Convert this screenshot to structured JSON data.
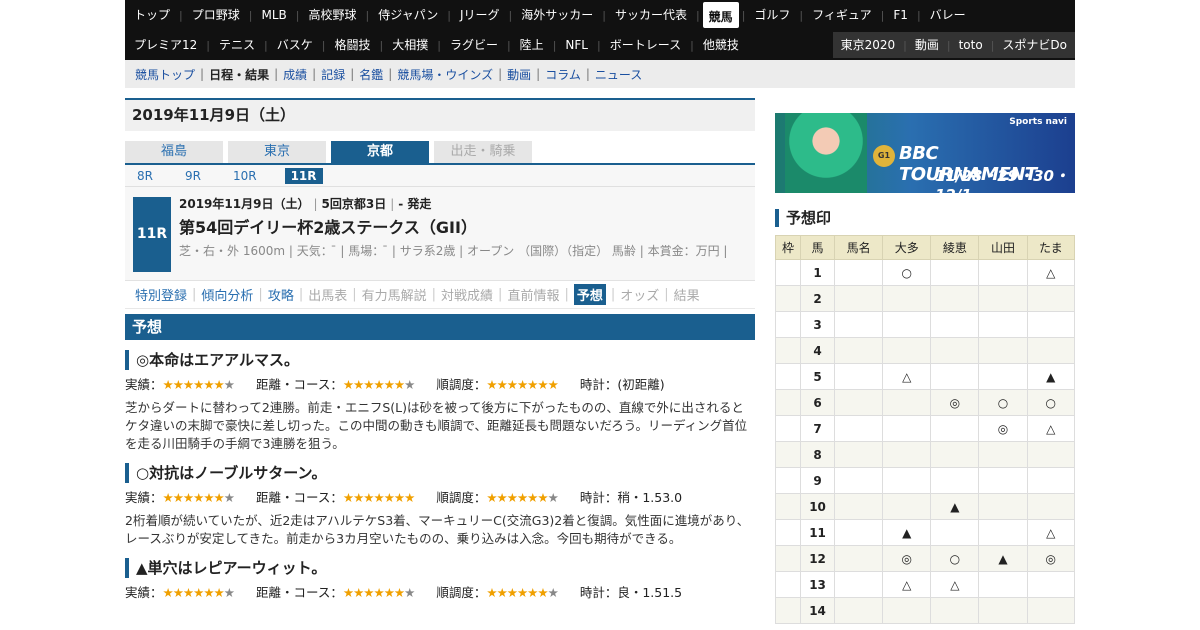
{
  "nav1": [
    {
      "label": "トップ"
    },
    {
      "label": "プロ野球"
    },
    {
      "label": "MLB"
    },
    {
      "label": "高校野球"
    },
    {
      "label": "侍ジャパン"
    },
    {
      "label": "Jリーグ"
    },
    {
      "label": "海外サッカー"
    },
    {
      "label": "サッカー代表"
    },
    {
      "label": "競馬",
      "active": true
    },
    {
      "label": "ゴルフ"
    },
    {
      "label": "フィギュア"
    },
    {
      "label": "F1"
    },
    {
      "label": "バレー"
    }
  ],
  "nav2": [
    {
      "label": "プレミア12"
    },
    {
      "label": "テニス"
    },
    {
      "label": "バスケ"
    },
    {
      "label": "格闘技"
    },
    {
      "label": "大相撲"
    },
    {
      "label": "ラグビー"
    },
    {
      "label": "陸上"
    },
    {
      "label": "NFL"
    },
    {
      "label": "ボートレース"
    },
    {
      "label": "他競技"
    }
  ],
  "nav2_right": [
    {
      "label": "東京2020"
    },
    {
      "label": "動画"
    },
    {
      "label": "toto"
    },
    {
      "label": "スポナビDo"
    }
  ],
  "subnav": [
    {
      "label": "競馬トップ"
    },
    {
      "label": "日程・結果",
      "current": true
    },
    {
      "label": "成績"
    },
    {
      "label": "記録"
    },
    {
      "label": "名鑑"
    },
    {
      "label": "競馬場・ウインズ"
    },
    {
      "label": "動画"
    },
    {
      "label": "コラム"
    },
    {
      "label": "ニュース"
    }
  ],
  "date_heading": "2019年11月9日（土）",
  "venues": [
    {
      "label": "福島",
      "state": ""
    },
    {
      "label": "東京",
      "state": ""
    },
    {
      "label": "京都",
      "state": "on"
    },
    {
      "label": "出走・騎乗",
      "state": "off"
    }
  ],
  "races": [
    {
      "label": "8R",
      "on": false
    },
    {
      "label": "9R",
      "on": false
    },
    {
      "label": "10R",
      "on": false
    },
    {
      "label": "11R",
      "on": true
    }
  ],
  "race": {
    "badge": "11R",
    "date": "2019年11月9日（土）",
    "meeting": "5回京都3日",
    "start": "- 発走",
    "name": "第54回デイリー杯2歳ステークス（GII）",
    "detail": "芝・右・外 1600m | 天気： ̄ | 馬場： ̄ | サラ系2歳 | オープン （国際）（指定） 馬齢 | 本賞金：万円 |"
  },
  "race_menu": [
    {
      "label": "特別登録",
      "state": ""
    },
    {
      "label": "傾向分析",
      "state": ""
    },
    {
      "label": "攻略",
      "state": ""
    },
    {
      "label": "出馬表",
      "state": "dis"
    },
    {
      "label": "有力馬解説",
      "state": "dis"
    },
    {
      "label": "対戦成績",
      "state": "dis"
    },
    {
      "label": "直前情報",
      "state": "dis"
    },
    {
      "label": "予想",
      "state": "on"
    },
    {
      "label": "オッズ",
      "state": "dis"
    },
    {
      "label": "結果",
      "state": "dis"
    }
  ],
  "yoso_heading": "予想",
  "picks": [
    {
      "title": "◎本命はエアアルマス。",
      "jisseki_label": "実績：",
      "jisseki_on": 6,
      "jisseki_off": 1,
      "kyori_label": "距離・コース：",
      "kyori_on": 6,
      "kyori_off": 1,
      "junchou_label": "順調度：",
      "junchou_on": 7,
      "junchou_off": 0,
      "time_label": "時計：(初距離)",
      "body": "芝からダートに替わって2連勝。前走・エニフS(L)は砂を被って後方に下がったものの、直線で外に出されるとケタ違いの末脚で豪快に差し切った。この中間の動きも順調で、距離延長も問題ないだろう。リーディング首位を走る川田騎手の手綱で3連勝を狙う。"
    },
    {
      "title": "○対抗はノーブルサターン。",
      "jisseki_label": "実績：",
      "jisseki_on": 6,
      "jisseki_off": 1,
      "kyori_label": "距離・コース：",
      "kyori_on": 7,
      "kyori_off": 0,
      "junchou_label": "順調度：",
      "junchou_on": 6,
      "junchou_off": 1,
      "time_label": "時計：稍・1.53.0",
      "body": "2桁着順が続いていたが、近2走はアハルテケS3着、マーキュリーC(交流G3)2着と復調。気性面に進境があり、レースぶりが安定してきた。前走から3カ月空いたものの、乗り込みは入念。今回も期待ができる。"
    },
    {
      "title": "▲単穴はレピアーウィット。",
      "jisseki_label": "実績：",
      "jisseki_on": 6,
      "jisseki_off": 1,
      "kyori_label": "距離・コース：",
      "kyori_on": 6,
      "kyori_off": 1,
      "junchou_label": "順調度：",
      "junchou_on": 6,
      "junchou_off": 1,
      "time_label": "時計：良・1.51.5",
      "body": ""
    }
  ],
  "banner": {
    "brand": "Sports navi",
    "title": "BBC TOURNAMENT",
    "grade": "G1",
    "dates": "11/28・29・30・12/1"
  },
  "yosojirushi_heading": "予想印",
  "table": {
    "headers": [
      "枠",
      "馬",
      "馬名",
      "大多",
      "綾恵",
      "山田",
      "たま"
    ],
    "rows": [
      [
        "",
        "1",
        "",
        "○",
        "",
        "",
        "△"
      ],
      [
        "",
        "2",
        "",
        "",
        "",
        "",
        ""
      ],
      [
        "",
        "3",
        "",
        "",
        "",
        "",
        ""
      ],
      [
        "",
        "4",
        "",
        "",
        "",
        "",
        ""
      ],
      [
        "",
        "5",
        "",
        "△",
        "",
        "",
        "▲"
      ],
      [
        "",
        "6",
        "",
        "",
        "◎",
        "○",
        "○"
      ],
      [
        "",
        "7",
        "",
        "",
        "",
        "◎",
        "△"
      ],
      [
        "",
        "8",
        "",
        "",
        "",
        "",
        ""
      ],
      [
        "",
        "9",
        "",
        "",
        "",
        "",
        ""
      ],
      [
        "",
        "10",
        "",
        "",
        "▲",
        "",
        ""
      ],
      [
        "",
        "11",
        "",
        "▲",
        "",
        "",
        "△"
      ],
      [
        "",
        "12",
        "",
        "◎",
        "○",
        "▲",
        "◎"
      ],
      [
        "",
        "13",
        "",
        "△",
        "△",
        "",
        ""
      ],
      [
        "",
        "14",
        "",
        "",
        "",
        "",
        ""
      ]
    ]
  }
}
